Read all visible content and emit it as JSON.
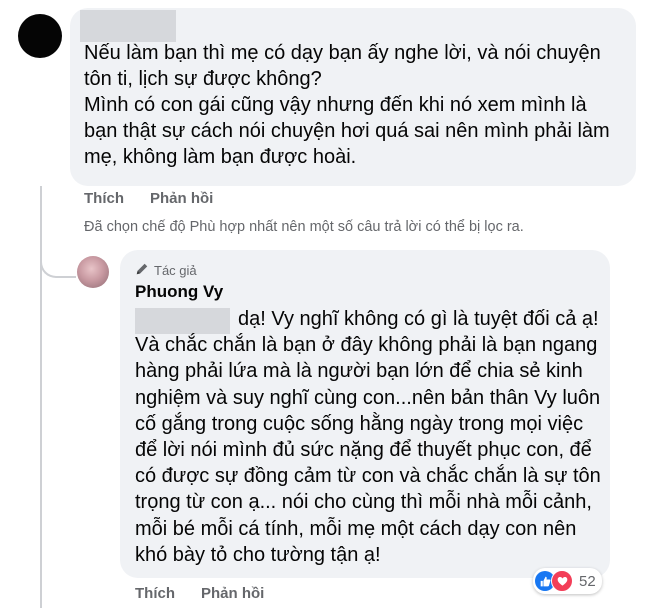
{
  "comment1": {
    "author_redacted": true,
    "lines": [
      "Nếu làm bạn thì mẹ có dạy bạn ấy nghe lời, và nói chuyện tôn ti, lịch sự được không?",
      "Mình có con gái cũng vậy nhưng đến khi nó xem mình là bạn thật sự cách nói chuyện hơi quá sai nên mình phải làm mẹ, không làm bạn được hoài."
    ],
    "like_label": "Thích",
    "reply_label": "Phản hồi"
  },
  "filter_note": "Đã chọn chế độ Phù hợp nhất nên một số câu trả lời có thể bị lọc ra.",
  "reply": {
    "badge_icon": "pencil-icon",
    "badge": "Tác giả",
    "author": "Phuong Vy",
    "text": "dạ! Vy nghĩ không có gì là tuyệt đối cả ạ! Và chắc chắn là bạn ở đây không phải là bạn ngang hàng phải lứa mà là người bạn lớn để chia sẻ kinh nghiệm và suy nghĩ cùng con...nên bản thân Vy luôn cố gắng trong cuộc sống hằng ngày trong mọi việc để lời nói mình đủ sức nặng để thuyết phục con, để có được sự đồng cảm từ con và chắc chắn là sự tôn trọng từ con ạ... nói cho cùng thì mỗi nhà mỗi cảnh, mỗi bé mỗi cá tính, mỗi mẹ một cách dạy con nên khó bày tỏ cho tường tận ạ!",
    "like_label": "Thích",
    "reply_label": "Phản hồi",
    "reaction_count": "52",
    "reaction_icons": [
      "like-icon",
      "love-icon"
    ]
  },
  "colors": {
    "bubble": "#f0f2f5",
    "meta": "#65676b",
    "like": "#1877f2",
    "love": "#f33e58"
  }
}
